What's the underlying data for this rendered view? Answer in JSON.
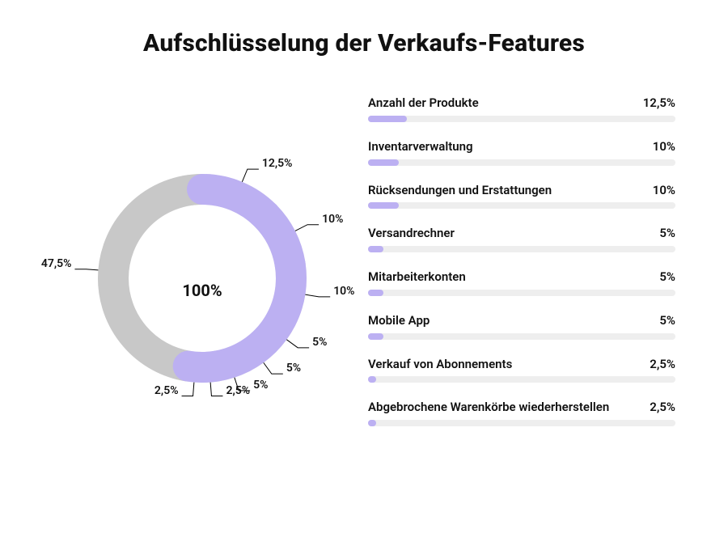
{
  "chart_data": {
    "type": "pie",
    "title": "Aufschlüsselung der Verkaufs-Features",
    "center_value": "100%",
    "remainder": {
      "label": "",
      "value": 47.5,
      "percent_label": "47,5%"
    },
    "series": [
      {
        "name": "Anzahl der Produkte",
        "value": 12.5,
        "percent_label": "12,5%"
      },
      {
        "name": "Inventarverwaltung",
        "value": 10,
        "percent_label": "10%"
      },
      {
        "name": "Rücksendungen und Erstattungen",
        "value": 10,
        "percent_label": "10%"
      },
      {
        "name": "Versandrechner",
        "value": 5,
        "percent_label": "5%"
      },
      {
        "name": "Mitarbeiterkonten",
        "value": 5,
        "percent_label": "5%"
      },
      {
        "name": "Mobile App",
        "value": 5,
        "percent_label": "5%"
      },
      {
        "name": "Verkauf von Abonnements",
        "value": 2.5,
        "percent_label": "2,5%"
      },
      {
        "name": "Abgebrochene Warenkörbe wiederherstellen",
        "value": 2.5,
        "percent_label": "2,5%"
      }
    ],
    "colors": {
      "segment": "#bcb0f2",
      "remainder": "#c8c8c8",
      "track": "#eeeeee"
    }
  }
}
